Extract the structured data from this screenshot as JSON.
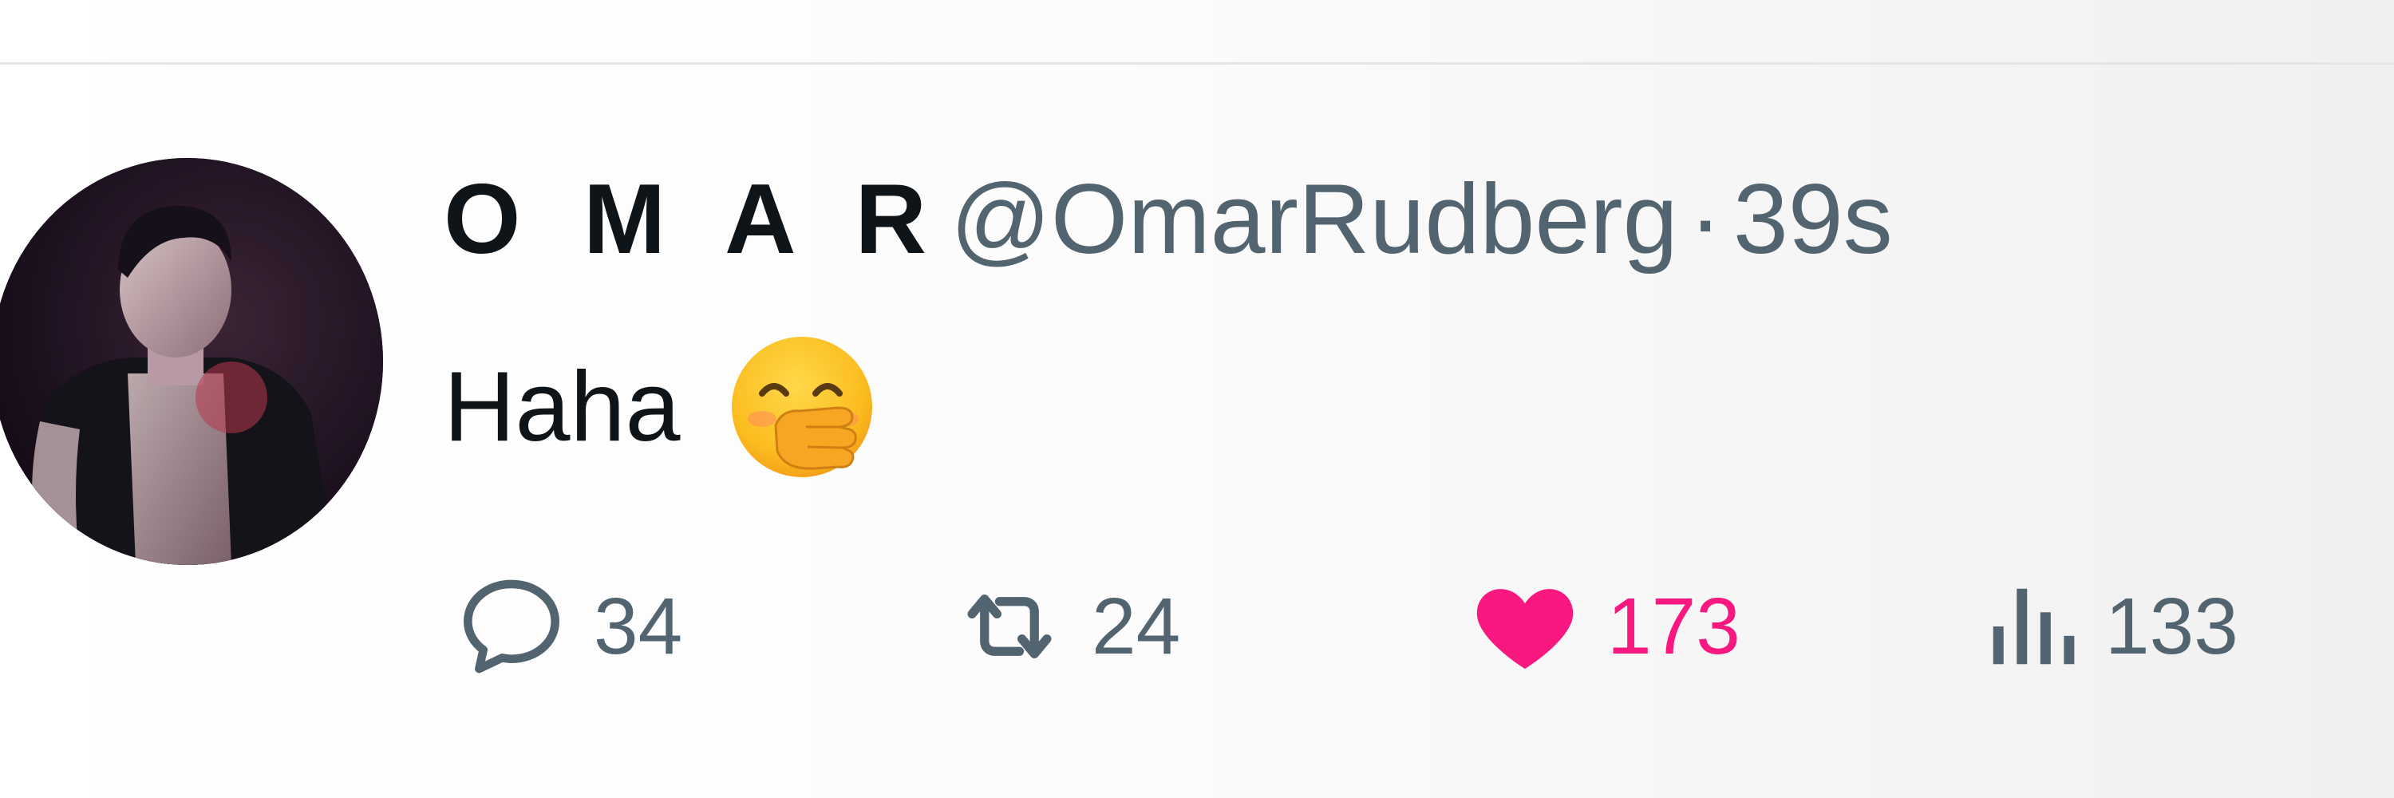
{
  "tweet": {
    "display_name": "O M A R",
    "handle": "@OmarRudberg",
    "separator": "·",
    "timestamp": "39s",
    "text": "Haha",
    "emoji": "hand-over-mouth-emoji",
    "avatar": "profile-photo"
  },
  "actions": {
    "reply": {
      "icon": "speech-bubble-icon",
      "count": "34"
    },
    "retweet": {
      "icon": "retweet-arrows-icon",
      "count": "24"
    },
    "like": {
      "icon": "heart-icon",
      "count": "173",
      "liked": true
    },
    "views": {
      "icon": "bar-chart-icon",
      "count": "133"
    }
  },
  "colors": {
    "text_primary": "#0f1419",
    "text_secondary": "#536471",
    "like_active": "#f91880",
    "divider": "#e3e5e8"
  }
}
